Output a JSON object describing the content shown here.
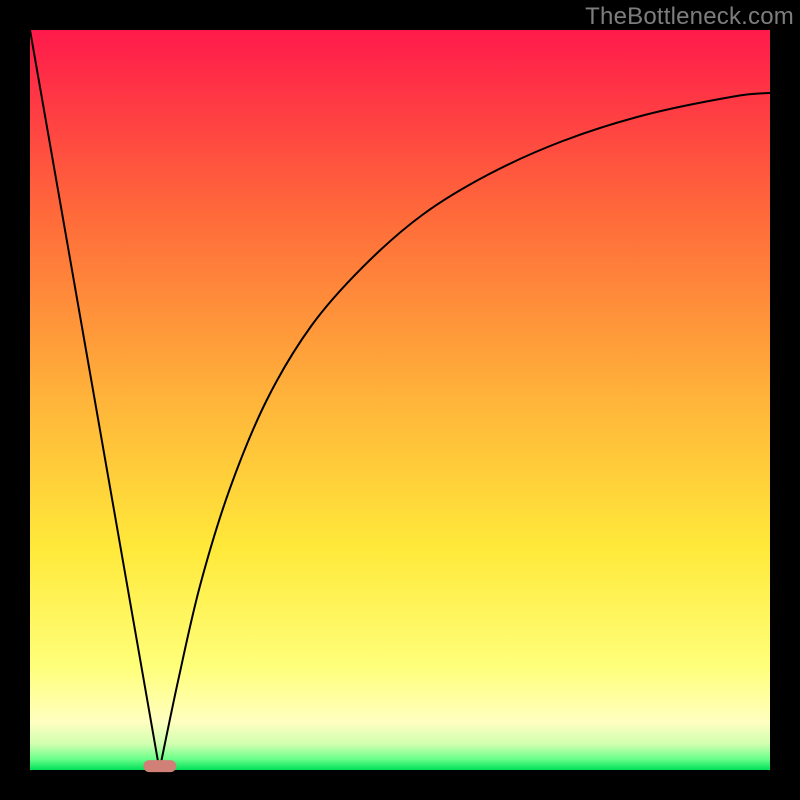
{
  "watermark": "TheBottleneck.com",
  "chart_data": {
    "type": "line",
    "title": "",
    "xlabel": "",
    "ylabel": "",
    "xlim": [
      0,
      100
    ],
    "ylim": [
      0,
      100
    ],
    "grid": false,
    "legend": false,
    "gradient_stops": [
      {
        "pos": 0.0,
        "color": "#ff1a4b"
      },
      {
        "pos": 0.25,
        "color": "#ff6a3a"
      },
      {
        "pos": 0.5,
        "color": "#ffb43a"
      },
      {
        "pos": 0.7,
        "color": "#ffe93a"
      },
      {
        "pos": 0.86,
        "color": "#ffff7a"
      },
      {
        "pos": 0.935,
        "color": "#ffffc0"
      },
      {
        "pos": 0.965,
        "color": "#d0ffb0"
      },
      {
        "pos": 0.985,
        "color": "#6bff8a"
      },
      {
        "pos": 1.0,
        "color": "#00e05a"
      }
    ],
    "series": [
      {
        "name": "left-v-branch",
        "x": [
          0,
          17.5
        ],
        "y": [
          100,
          0
        ]
      },
      {
        "name": "right-curve",
        "x": [
          17.5,
          20,
          23,
          27,
          32,
          38,
          45,
          53,
          62,
          72,
          83,
          95,
          100
        ],
        "y": [
          0,
          12,
          25,
          38,
          50,
          60,
          68,
          75,
          80.5,
          85,
          88.5,
          91,
          91.5
        ]
      }
    ],
    "marker": {
      "x": 17.5,
      "y": 0.5,
      "width_pct": 4.5,
      "height_pct": 1.6,
      "color": "#d18078"
    }
  }
}
